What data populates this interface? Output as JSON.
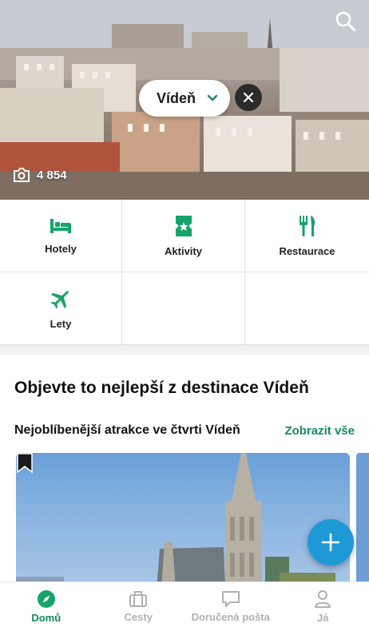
{
  "hero": {
    "destination_label": "Vídeň",
    "photo_count": "4 854"
  },
  "categories": [
    {
      "label": "Hotely",
      "icon": "bed-icon"
    },
    {
      "label": "Aktivity",
      "icon": "ticket-icon"
    },
    {
      "label": "Restaurace",
      "icon": "fork-knife-icon"
    },
    {
      "label": "Lety",
      "icon": "plane-icon"
    }
  ],
  "content": {
    "section_title": "Objevte to nejlepší z destinace Vídeň",
    "subsection_title": "Nejoblíbenější atrakce ve čtvrti Vídeň",
    "see_all": "Zobrazit vše"
  },
  "bottom_nav": {
    "items": [
      {
        "label": "Domů",
        "icon": "compass-icon",
        "active": true
      },
      {
        "label": "Cesty",
        "icon": "suitcase-icon",
        "active": false
      },
      {
        "label": "Doručená pošta",
        "icon": "chat-icon",
        "active": false
      },
      {
        "label": "Já",
        "icon": "person-icon",
        "active": false
      }
    ]
  },
  "colors": {
    "accent_green": "#138a5c",
    "icon_green": "#16a36b",
    "fab_blue": "#1f98d6",
    "inactive_gray": "#b0b0b0"
  }
}
